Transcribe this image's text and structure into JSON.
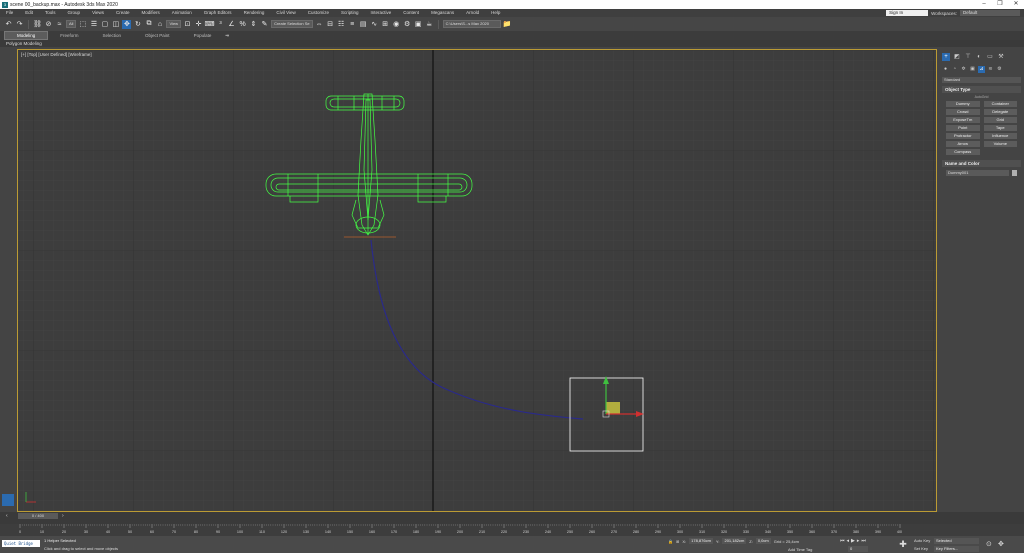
{
  "window": {
    "title": "scene 00_backup.max - Autodesk 3ds Max 2020",
    "controls": [
      "–",
      "❐",
      "✕"
    ]
  },
  "menu": {
    "items": [
      "File",
      "Edit",
      "Tools",
      "Group",
      "Views",
      "Create",
      "Modifiers",
      "Animation",
      "Graph Editors",
      "Rendering",
      "Civil View",
      "Customize",
      "Scripting",
      "Interactive",
      "Content",
      "Megascans",
      "Arnold",
      "Help"
    ],
    "sign_in": "Sign In",
    "workspaces_label": "Workspaces:",
    "workspace_value": "Default"
  },
  "toolbar": {
    "selection_filter": "All",
    "reference_coord": "View",
    "named_selection": "Create Selection Se",
    "project_path": "C:\\Users\\S...s Max 2020"
  },
  "ribbon": {
    "tabs": [
      "Modeling",
      "Freeform",
      "Selection",
      "Object Paint",
      "Populate"
    ],
    "sub_label": "Polygon Modeling"
  },
  "viewport": {
    "label": "[+] [Top] [User Defined] [Wireframe]"
  },
  "command_panel": {
    "category": "Standard",
    "object_type_title": "Object Type",
    "autogrid": "AutoGrid",
    "object_buttons": [
      "Dummy",
      "Container",
      "Crowd",
      "Delegate",
      "ExposeTm",
      "Grid",
      "Point",
      "Tape",
      "Protractor",
      "Influence",
      "Arrow",
      "Volume",
      "Compass"
    ],
    "name_color_title": "Name and Color",
    "object_name": "Dummy001"
  },
  "timeline": {
    "frame_display": "0 / 400",
    "ticks": [
      "0",
      "10",
      "20",
      "30",
      "40",
      "50",
      "60",
      "70",
      "80",
      "90",
      "100",
      "110",
      "120",
      "130",
      "140",
      "150",
      "160",
      "170",
      "180",
      "190",
      "200",
      "210",
      "220",
      "230",
      "240",
      "250",
      "260",
      "270",
      "280",
      "290",
      "300",
      "310",
      "320",
      "330",
      "340",
      "350",
      "360",
      "370",
      "380",
      "390",
      "400"
    ]
  },
  "status": {
    "maxscript": "Quiet Bridge",
    "line1": "1 Helper Selected",
    "line2": "Click and drag to select and move objects",
    "x_label": "X:",
    "x_value": "178,876cm",
    "y_label": "Y:",
    "y_value": "201,182cm",
    "z_label": "Z:",
    "z_value": "0,0cm",
    "grid": "Grid = 25,4cm",
    "add_time_tag": "Add Time Tag",
    "frame_field": "0",
    "auto_key": "Auto Key",
    "set_key": "Set Key",
    "selected": "Selected",
    "key_filters": "Key Filters..."
  },
  "colors": {
    "wireframe_green": "#44ff44",
    "path_blue": "#2a2a8a",
    "viewport_border": "#bb9b34",
    "accent_blue": "#2b6bb0"
  }
}
